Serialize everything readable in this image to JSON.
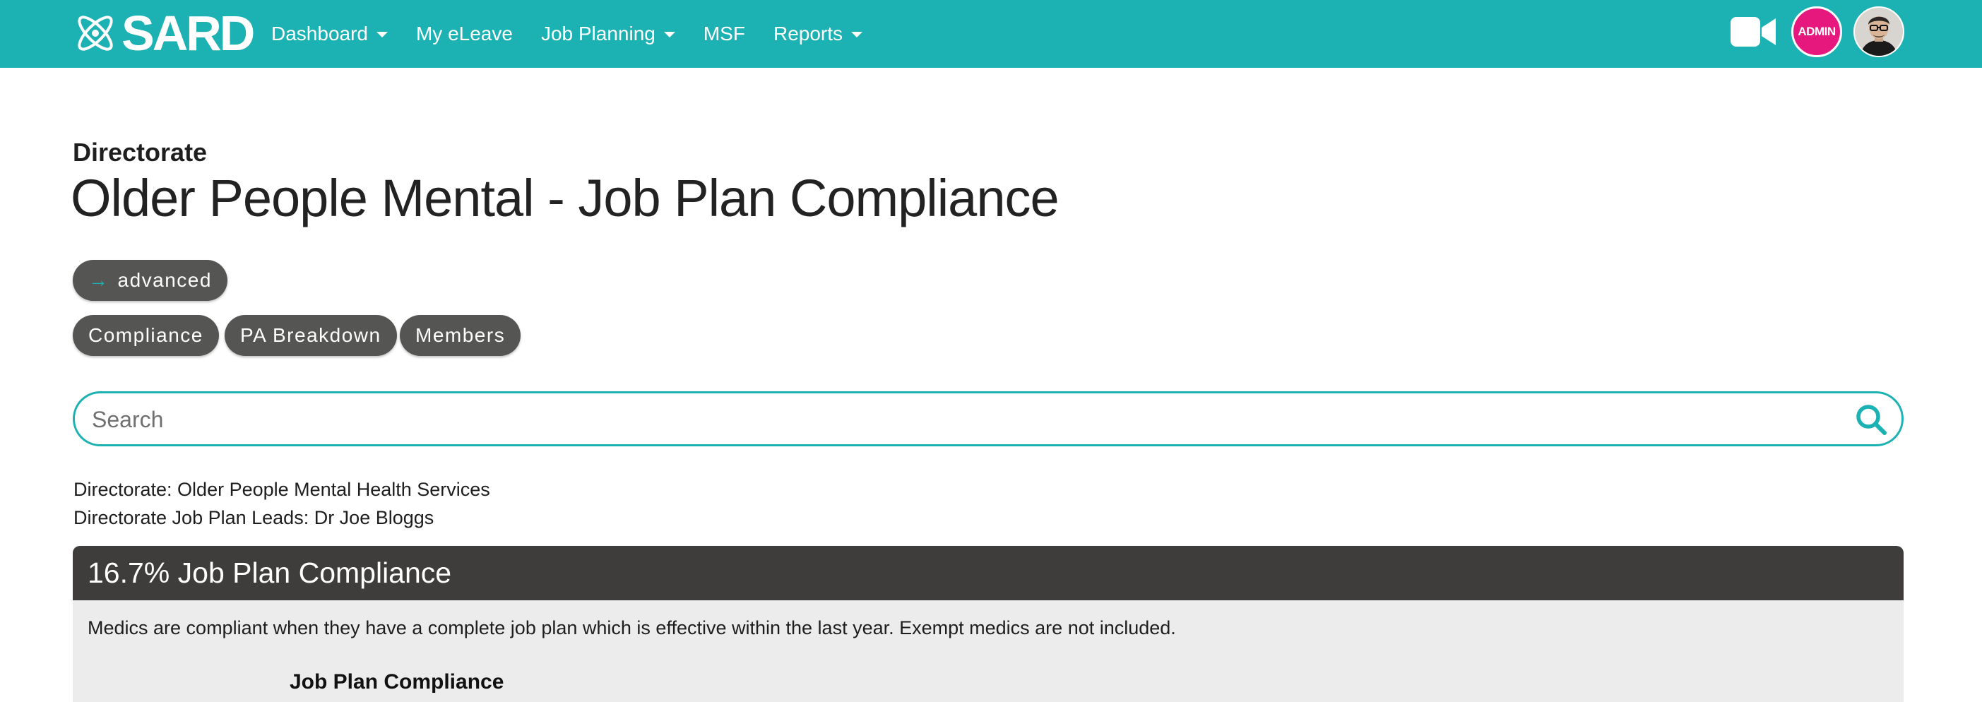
{
  "colors": {
    "brand": "#1cb1b2",
    "pill": "#555553",
    "card_header": "#3e3d3c",
    "card_body": "#edecec",
    "admin_badge": "#e6177d"
  },
  "navbar": {
    "brand": "SARD",
    "logo_icon": "atom-logo-icon",
    "items": [
      {
        "label": "Dashboard",
        "has_dropdown": true
      },
      {
        "label": "My eLeave",
        "has_dropdown": false
      },
      {
        "label": "Job Planning",
        "has_dropdown": true
      },
      {
        "label": "MSF",
        "has_dropdown": false
      },
      {
        "label": "Reports",
        "has_dropdown": true
      }
    ],
    "video_icon": "video-camera-icon",
    "admin_label": "ADMIN",
    "avatar_icon": "user-avatar"
  },
  "header": {
    "eyebrow": "Directorate",
    "title": "Older People Mental - Job Plan Compliance"
  },
  "advanced_button": {
    "icon": "arrow-right-icon",
    "label": "advanced"
  },
  "tabs": [
    {
      "label": "Compliance"
    },
    {
      "label": "PA Breakdown"
    },
    {
      "label": "Members"
    }
  ],
  "search": {
    "placeholder": "Search",
    "value": "",
    "icon": "search-icon"
  },
  "info": {
    "directorate": "Directorate: Older People Mental Health Services",
    "leads": "Directorate Job Plan Leads: Dr Joe Bloggs"
  },
  "compliance_card": {
    "heading": "16.7% Job Plan Compliance",
    "description": "Medics are compliant when they have a complete job plan which is effective within the last year. Exempt medics are not included.",
    "subheading": "Job Plan Compliance"
  }
}
